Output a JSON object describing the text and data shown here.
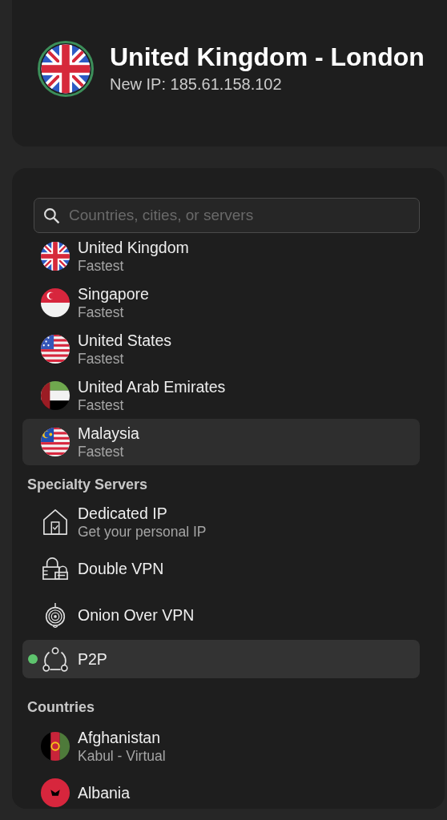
{
  "connection": {
    "title": "United Kingdom - London",
    "ip": "New IP: 185.61.158.102",
    "connected": true
  },
  "search": {
    "placeholder": "Countries, cities, or servers"
  },
  "recents": [
    {
      "name": "United Kingdom",
      "subtitle": "Fastest",
      "highlighted": false
    },
    {
      "name": "Singapore",
      "subtitle": "Fastest",
      "highlighted": false
    },
    {
      "name": "United States",
      "subtitle": "Fastest",
      "highlighted": false
    },
    {
      "name": "United Arab Emirates",
      "subtitle": "Fastest",
      "highlighted": false
    },
    {
      "name": "Malaysia",
      "subtitle": "Fastest",
      "highlighted": true
    }
  ],
  "specialty": {
    "heading": "Specialty Servers",
    "items": [
      {
        "kind": "dedicated",
        "name": "Dedicated IP",
        "subtitle": "Get your personal IP",
        "selected": false
      },
      {
        "kind": "double",
        "name": "Double VPN",
        "selected": false
      },
      {
        "kind": "onion",
        "name": "Onion Over VPN",
        "selected": false
      },
      {
        "kind": "p2p",
        "name": "P2P",
        "selected": true
      }
    ]
  },
  "countries": {
    "heading": "Countries",
    "items": [
      {
        "name": "Afghanistan",
        "subtitle": "Kabul - Virtual"
      },
      {
        "name": "Albania"
      }
    ]
  }
}
